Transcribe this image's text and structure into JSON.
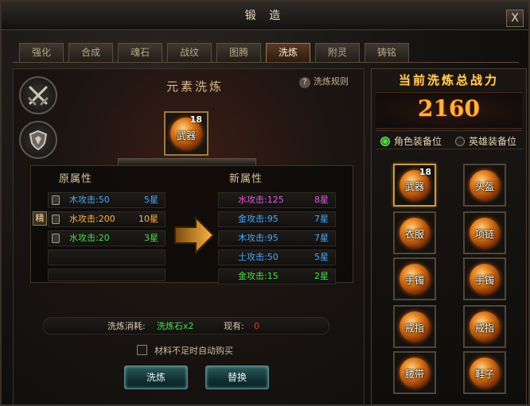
{
  "window": {
    "title": "锻 造",
    "close_label": "X"
  },
  "tabs": [
    {
      "label": "强化",
      "active": false
    },
    {
      "label": "合成",
      "active": false
    },
    {
      "label": "魂石",
      "active": false
    },
    {
      "label": "战纹",
      "active": false
    },
    {
      "label": "图腾",
      "active": false
    },
    {
      "label": "洗炼",
      "active": true
    },
    {
      "label": "附灵",
      "active": false
    },
    {
      "label": "铸铭",
      "active": false
    }
  ],
  "left": {
    "section_title": "元素洗炼",
    "help_label": "洗炼规则",
    "weapon": {
      "label": "武器",
      "level": "18"
    },
    "original": {
      "header": "原属性",
      "lock_label": "精",
      "rows": [
        {
          "name": "木攻击:50",
          "star": "5星",
          "color": "#4aa8ff"
        },
        {
          "name": "水攻击:200",
          "star": "10星",
          "color": "#ffb64a"
        },
        {
          "name": "水攻击:20",
          "star": "3星",
          "color": "#49e04a"
        }
      ]
    },
    "new": {
      "header": "新属性",
      "rows": [
        {
          "name": "水攻击:125",
          "star": "8星",
          "color": "#e45adf"
        },
        {
          "name": "金攻击:95",
          "star": "7星",
          "color": "#4aa8ff"
        },
        {
          "name": "木攻击:95",
          "star": "7星",
          "color": "#4aa8ff"
        },
        {
          "name": "土攻击:50",
          "star": "5星",
          "color": "#4aa8ff"
        },
        {
          "name": "金攻击:15",
          "star": "2星",
          "color": "#49e04a"
        }
      ]
    },
    "cost": {
      "label": "洗炼消耗:",
      "item": "洗炼石x2",
      "have_label": "现有:",
      "have_value": "0"
    },
    "auto_buy_label": "材料不足时自动购买",
    "refine_button": "洗炼",
    "replace_button": "替换"
  },
  "right": {
    "title": "当前洗炼总战力",
    "power": "2160",
    "radio_role": "角色装备位",
    "radio_hero": "英雄装备位",
    "slots": [
      {
        "label": "武器",
        "level": "18",
        "selected": true
      },
      {
        "label": "头盔",
        "level": "",
        "selected": false
      },
      {
        "label": "衣服",
        "level": "",
        "selected": false
      },
      {
        "label": "项链",
        "level": "",
        "selected": false
      },
      {
        "label": "手镯",
        "level": "",
        "selected": false
      },
      {
        "label": "手镯",
        "level": "",
        "selected": false
      },
      {
        "label": "戒指",
        "level": "",
        "selected": false
      },
      {
        "label": "戒指",
        "level": "",
        "selected": false
      },
      {
        "label": "腰带",
        "level": "",
        "selected": false
      },
      {
        "label": "鞋子",
        "level": "",
        "selected": false
      }
    ]
  },
  "colors": {
    "accent_gold": "#ffb33a",
    "button_teal": "#2f5a5c",
    "cost_green": "#49e04a",
    "cost_red": "#e53a2a"
  }
}
